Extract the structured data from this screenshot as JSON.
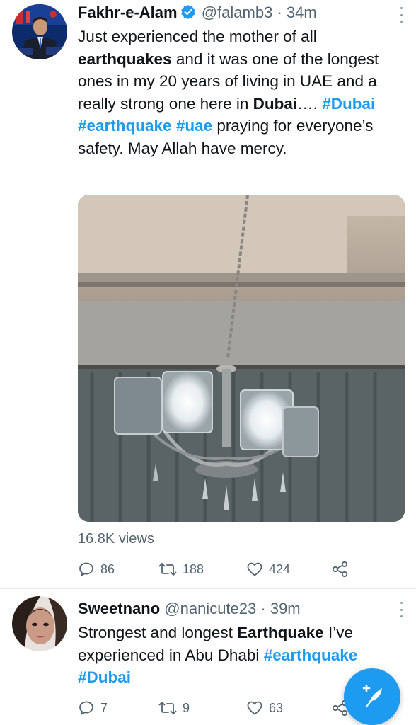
{
  "tweets": [
    {
      "author": {
        "name": "Fakhr-e-Alam",
        "handle": "@falamb3",
        "verified": true
      },
      "time": "34m",
      "text_runs": [
        {
          "t": "Just experienced the mother of all ",
          "style": "normal"
        },
        {
          "t": "earthquakes",
          "style": "bold"
        },
        {
          "t": " and it was one of the longest ones in my 20 years of living in UAE and a really strong one here in ",
          "style": "normal"
        },
        {
          "t": "Dubai",
          "style": "bold"
        },
        {
          "t": "…. ",
          "style": "normal"
        },
        {
          "t": "#Dubai",
          "style": "hashtag"
        },
        {
          "t": " ",
          "style": "normal"
        },
        {
          "t": "#earthquake",
          "style": "hashtag"
        },
        {
          "t": " ",
          "style": "normal"
        },
        {
          "t": "#uae",
          "style": "hashtag"
        },
        {
          "t": " praying for everyone’s safety. May Allah have mercy.",
          "style": "normal"
        }
      ],
      "media": {
        "type": "photo",
        "subject": "chandelier"
      },
      "views": "16.8K views",
      "replies": "86",
      "retweets": "188",
      "likes": "424"
    },
    {
      "author": {
        "name": "Sweetnano",
        "handle": "@nanicute23",
        "verified": false
      },
      "time": "39m",
      "text_runs": [
        {
          "t": "Strongest and longest ",
          "style": "normal"
        },
        {
          "t": "Earthquake",
          "style": "bold"
        },
        {
          "t": " I’ve experienced in Abu Dhabi ",
          "style": "normal"
        },
        {
          "t": "#earthquake",
          "style": "hashtag"
        },
        {
          "t": " ",
          "style": "normal"
        },
        {
          "t": "#Dubai",
          "style": "hashtag"
        }
      ],
      "replies": "7",
      "retweets": "9",
      "likes": "63"
    }
  ],
  "compose_button": {
    "icon": "compose-feather-icon"
  },
  "colors": {
    "accent": "#1d9bf0",
    "secondary_text": "#536471",
    "text": "#0f1419"
  }
}
